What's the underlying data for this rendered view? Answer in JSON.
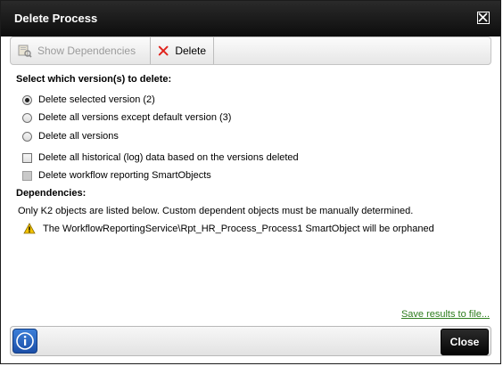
{
  "dialog": {
    "title": "Delete Process",
    "close_icon": "close-box-icon"
  },
  "toolbar": {
    "show_dependencies_label": "Show Dependencies",
    "show_dependencies_icon": "dependencies-icon",
    "delete_label": "Delete",
    "delete_icon": "red-x-icon"
  },
  "versions": {
    "heading": "Select which version(s) to delete:",
    "options": [
      {
        "label": "Delete selected version (2)",
        "selected": true
      },
      {
        "label": "Delete all versions except default version (3)",
        "selected": false
      },
      {
        "label": "Delete all versions",
        "selected": false
      }
    ]
  },
  "checkboxes": [
    {
      "label": "Delete all historical (log) data based on the versions deleted",
      "checked": false,
      "disabled": false
    },
    {
      "label": "Delete workflow reporting SmartObjects",
      "checked": false,
      "disabled": true
    }
  ],
  "dependencies": {
    "heading": "Dependencies:",
    "note": "Only K2 objects are listed below. Custom dependent objects must be manually determined.",
    "warning": "The WorkflowReportingService\\Rpt_HR_Process_Process1 SmartObject will be orphaned",
    "warning_icon": "warning-icon"
  },
  "save_link": "Save results to file...",
  "footer": {
    "info_icon": "info-icon",
    "close_label": "Close"
  },
  "colors": {
    "titlebar": "#111111",
    "link": "#2e7d1e",
    "info": "#2a63c0",
    "warning": "#f2c200"
  }
}
